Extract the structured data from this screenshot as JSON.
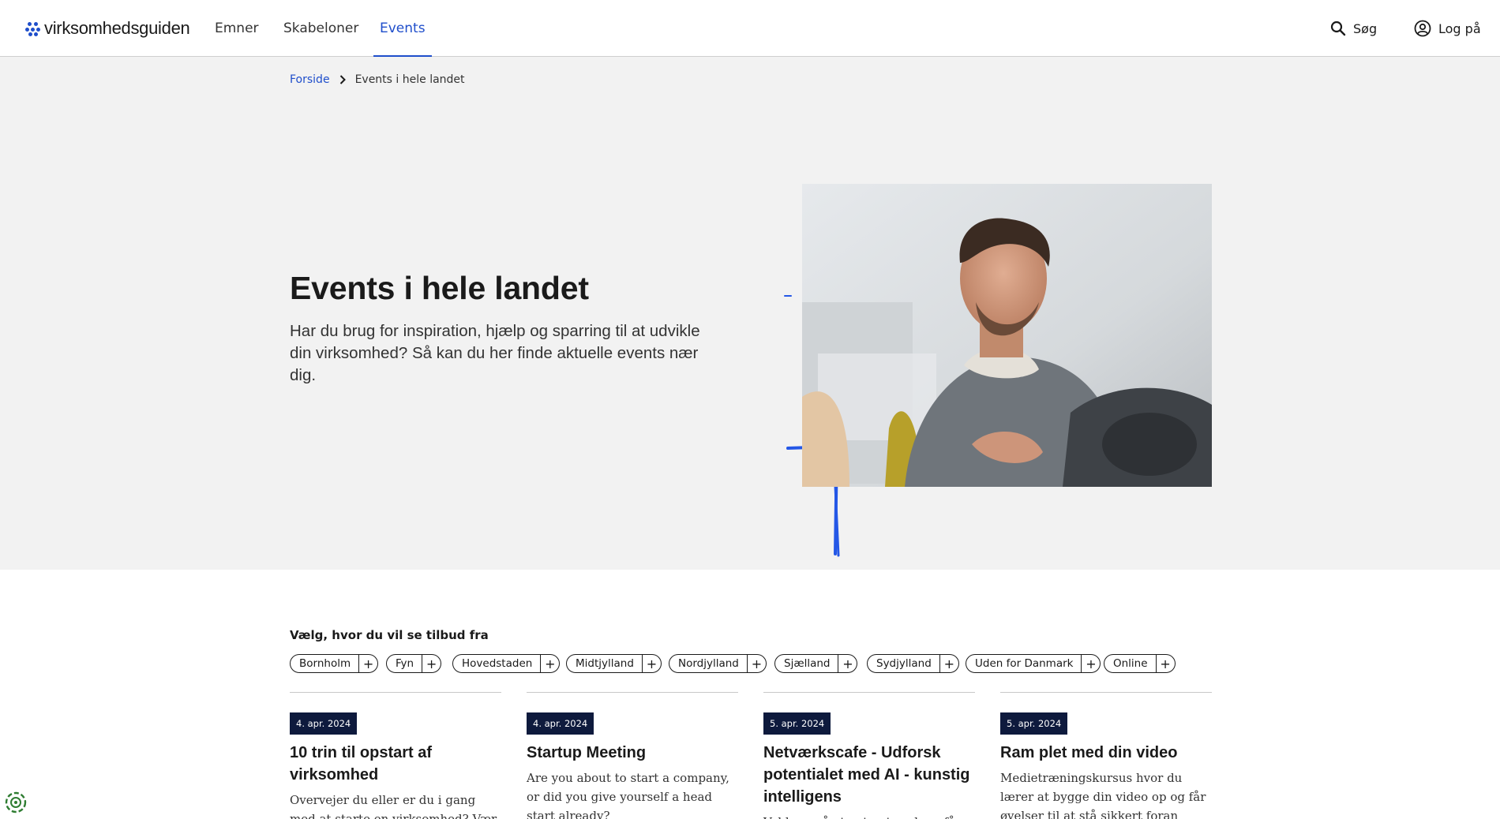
{
  "header": {
    "logo_text": "virksomhedsguiden",
    "nav": [
      {
        "label": "Emner"
      },
      {
        "label": "Skabeloner"
      },
      {
        "label": "Events",
        "active": true
      }
    ],
    "search_label": "Søg",
    "login_label": "Log på"
  },
  "breadcrumb": {
    "home": "Forside",
    "current": "Events i hele landet"
  },
  "hero": {
    "title": "Events i hele landet",
    "text": "Har du brug for inspiration, hjælp og sparring til at udvikle din virksomhed? Så kan du her finde aktuelle events nær dig."
  },
  "filters": {
    "label": "Vælg, hvor du vil se tilbud fra",
    "chips": [
      "Bornholm",
      "Fyn",
      "Hovedstaden",
      "Midtjylland",
      "Nordjylland",
      "Sjælland",
      "Sydjylland",
      "Uden for Danmark",
      "Online"
    ]
  },
  "events": [
    {
      "date": "4. apr. 2024",
      "title": "10 trin til opstart af virksomhed",
      "description": "Overvejer du eller er du i gang med at starte en virksomhed? Vær med"
    },
    {
      "date": "4. apr. 2024",
      "title": "Startup Meeting",
      "description": "Are you about to start a company, or did you give yourself a head start already?"
    },
    {
      "date": "5. apr. 2024",
      "title": "Netværkscafe - Udforsk potentialet med AI - kunstig intelligens",
      "description": "Vel kom på et nyt netværk og få"
    },
    {
      "date": "5. apr. 2024",
      "title": "Ram plet med din video",
      "description": "Medietræningskursus hvor du lærer at bygge din video op og får øvelser til at stå sikkert foran"
    }
  ],
  "colors": {
    "accent": "#1f4ecb",
    "hero_bg": "#f2f2f2",
    "date_badge": "#0e1a3d"
  }
}
